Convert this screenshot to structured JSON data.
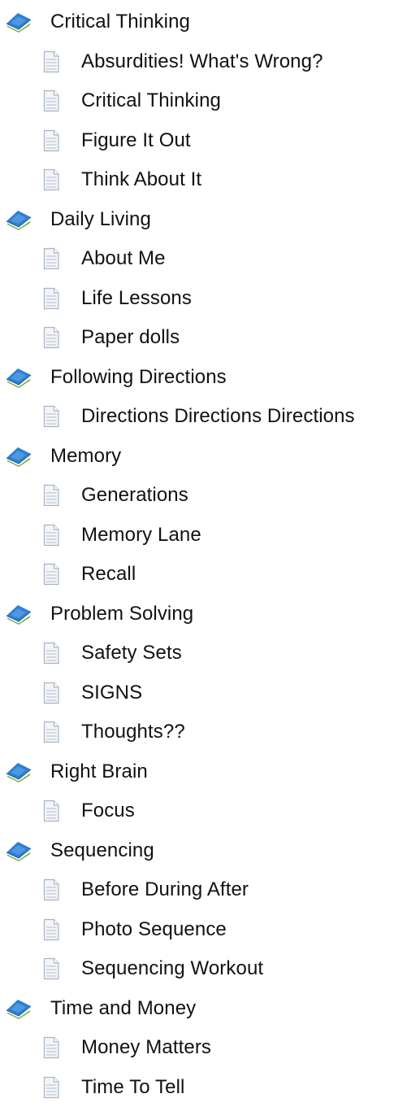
{
  "tree": {
    "categories": [
      {
        "label": "Critical Thinking",
        "icon": "book-icon",
        "items": [
          {
            "label": "Absurdities!  What's Wrong?",
            "icon": "page-icon"
          },
          {
            "label": "Critical Thinking",
            "icon": "page-icon"
          },
          {
            "label": "Figure It Out",
            "icon": "page-icon"
          },
          {
            "label": "Think About It",
            "icon": "page-icon"
          }
        ]
      },
      {
        "label": "Daily Living",
        "icon": "book-icon",
        "items": [
          {
            "label": "About Me",
            "icon": "page-icon"
          },
          {
            "label": "Life Lessons",
            "icon": "page-icon"
          },
          {
            "label": "Paper dolls",
            "icon": "page-icon"
          }
        ]
      },
      {
        "label": "Following Directions",
        "icon": "book-icon",
        "items": [
          {
            "label": "Directions Directions Directions",
            "icon": "page-icon"
          }
        ]
      },
      {
        "label": "Memory",
        "icon": "book-icon",
        "items": [
          {
            "label": "Generations",
            "icon": "page-icon"
          },
          {
            "label": "Memory Lane",
            "icon": "page-icon"
          },
          {
            "label": "Recall",
            "icon": "page-icon"
          }
        ]
      },
      {
        "label": "Problem Solving",
        "icon": "book-icon",
        "items": [
          {
            "label": "Safety Sets",
            "icon": "page-icon"
          },
          {
            "label": "SIGNS",
            "icon": "page-icon"
          },
          {
            "label": "Thoughts??",
            "icon": "page-icon"
          }
        ]
      },
      {
        "label": "Right Brain",
        "icon": "book-icon",
        "items": [
          {
            "label": "Focus",
            "icon": "page-icon"
          }
        ]
      },
      {
        "label": "Sequencing",
        "icon": "book-icon",
        "items": [
          {
            "label": "Before During After",
            "icon": "page-icon"
          },
          {
            "label": "Photo Sequence",
            "icon": "page-icon"
          },
          {
            "label": "Sequencing Workout",
            "icon": "page-icon"
          }
        ]
      },
      {
        "label": "Time and Money",
        "icon": "book-icon",
        "items": [
          {
            "label": "Money Matters",
            "icon": "page-icon"
          },
          {
            "label": "Time To Tell",
            "icon": "page-icon"
          }
        ]
      }
    ]
  },
  "colors": {
    "book_blue": "#2f7fd0",
    "book_blue_dark": "#1f5fa8",
    "book_green": "#6ea83a",
    "page_fill": "#f3f5f8",
    "page_border": "#a9b4c2",
    "page_lines": "#c9d2dd",
    "text": "#111111"
  }
}
